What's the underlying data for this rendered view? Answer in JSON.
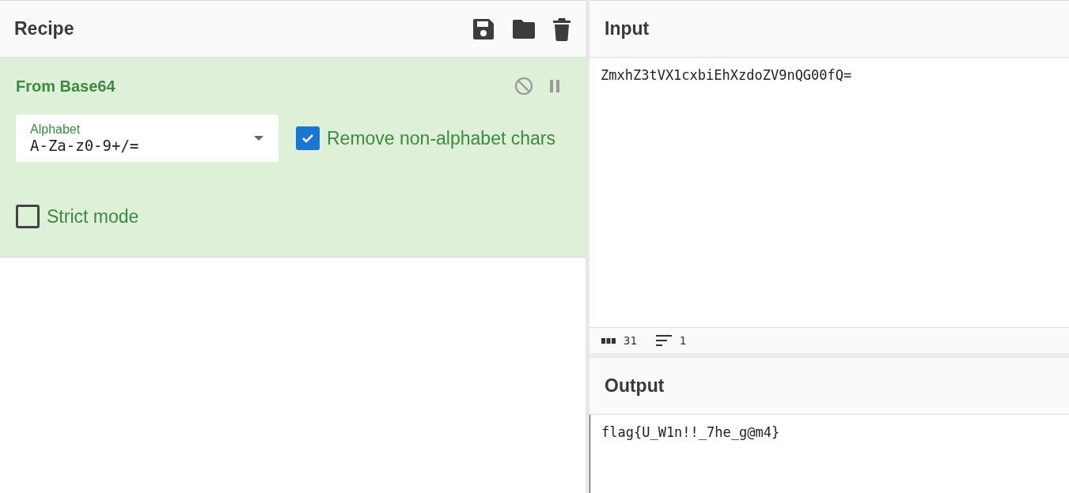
{
  "recipe": {
    "title": "Recipe",
    "operation": {
      "name": "From Base64",
      "dropdown": {
        "label": "Alphabet",
        "value": "A-Za-z0-9+/="
      },
      "options": [
        {
          "label": "Remove non-alphabet chars",
          "checked": true
        },
        {
          "label": "Strict mode",
          "checked": false
        }
      ]
    }
  },
  "input": {
    "title": "Input",
    "value": "ZmxhZ3tVX1cxbiEhXzdoZV9nQG00fQ=",
    "status": {
      "length": "31",
      "lines": "1"
    }
  },
  "output": {
    "title": "Output",
    "value": "flag{U_W1n!!_7he_g@m4}"
  }
}
